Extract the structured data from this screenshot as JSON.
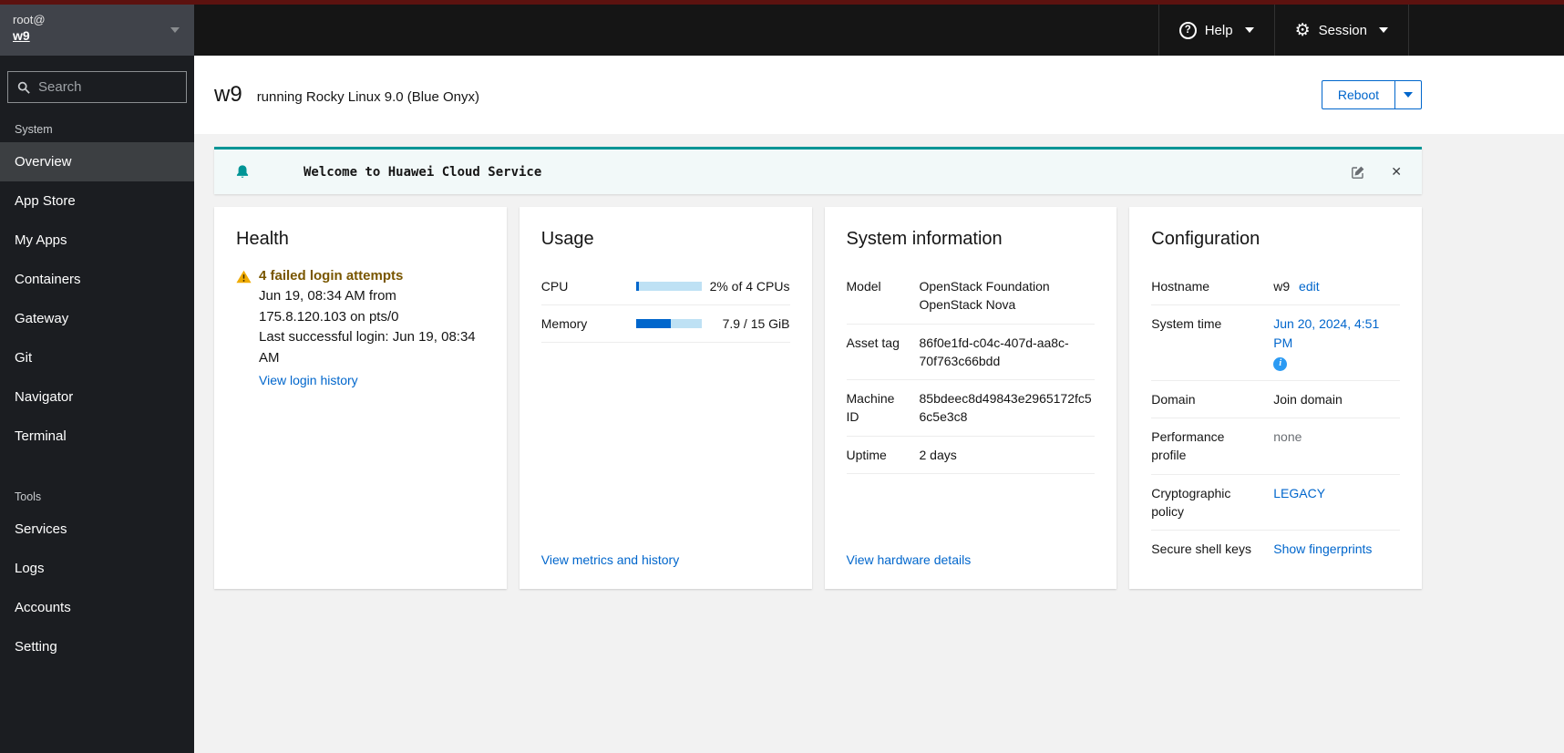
{
  "colors": {
    "masthead_accent": "#5c120f",
    "link": "#0066cc",
    "warning_icon": "#f0ab00",
    "warning_text": "#795600",
    "alert_accent": "#009596",
    "progress_fill": "#0066cc",
    "progress_track": "#bee1f4",
    "sidebar_bg": "#1b1d21"
  },
  "masthead": {
    "user": {
      "line1": "root@",
      "line2": "w9"
    },
    "help_label": "Help",
    "session_label": "Session"
  },
  "sidebar": {
    "search_placeholder": "Search",
    "sections": [
      {
        "label": "System",
        "items": [
          "Overview",
          "App Store",
          "My Apps",
          "Containers",
          "Gateway",
          "Git",
          "Navigator",
          "Terminal"
        ]
      },
      {
        "label": "Tools",
        "items": [
          "Services",
          "Logs",
          "Accounts",
          "Setting"
        ]
      }
    ],
    "active_item": "Overview"
  },
  "header": {
    "hostname": "w9",
    "os": "running Rocky Linux 9.0 (Blue Onyx)",
    "reboot_label": "Reboot"
  },
  "alert": {
    "title": "Welcome to Huawei Cloud Service"
  },
  "cards": {
    "health": {
      "title": "Health",
      "warning_title": "4 failed login attempts",
      "detail1": "Jun 19, 08:34 AM from 175.8.120.103 on pts/0",
      "detail2": "Last successful login: Jun 19, 08:34 AM",
      "link": "View login history"
    },
    "usage": {
      "title": "Usage",
      "rows": [
        {
          "label": "CPU",
          "percent": 2,
          "text": "2% of 4 CPUs"
        },
        {
          "label": "Memory",
          "percent": 52.7,
          "text": "7.9 / 15 GiB"
        }
      ],
      "link": "View metrics and history"
    },
    "system_info": {
      "title": "System information",
      "rows": [
        {
          "label": "Model",
          "value": "OpenStack Foundation OpenStack Nova"
        },
        {
          "label": "Asset tag",
          "value": "86f0e1fd-c04c-407d-aa8c-70f763c66bdd"
        },
        {
          "label": "Machine ID",
          "value": "85bdeec8d49843e2965172fc56c5e3c8"
        },
        {
          "label": "Uptime",
          "value": "2 days"
        }
      ],
      "link": "View hardware details"
    },
    "configuration": {
      "title": "Configuration",
      "hostname_label": "Hostname",
      "hostname_value": "w9",
      "hostname_edit": "edit",
      "system_time_label": "System time",
      "system_time_value": "Jun 20, 2024, 4:51 PM",
      "domain_label": "Domain",
      "domain_value": "Join domain",
      "perf_label": "Performance profile",
      "perf_value": "none",
      "crypto_label": "Cryptographic policy",
      "crypto_value": "LEGACY",
      "ssh_label": "Secure shell keys",
      "ssh_value": "Show fingerprints"
    }
  }
}
